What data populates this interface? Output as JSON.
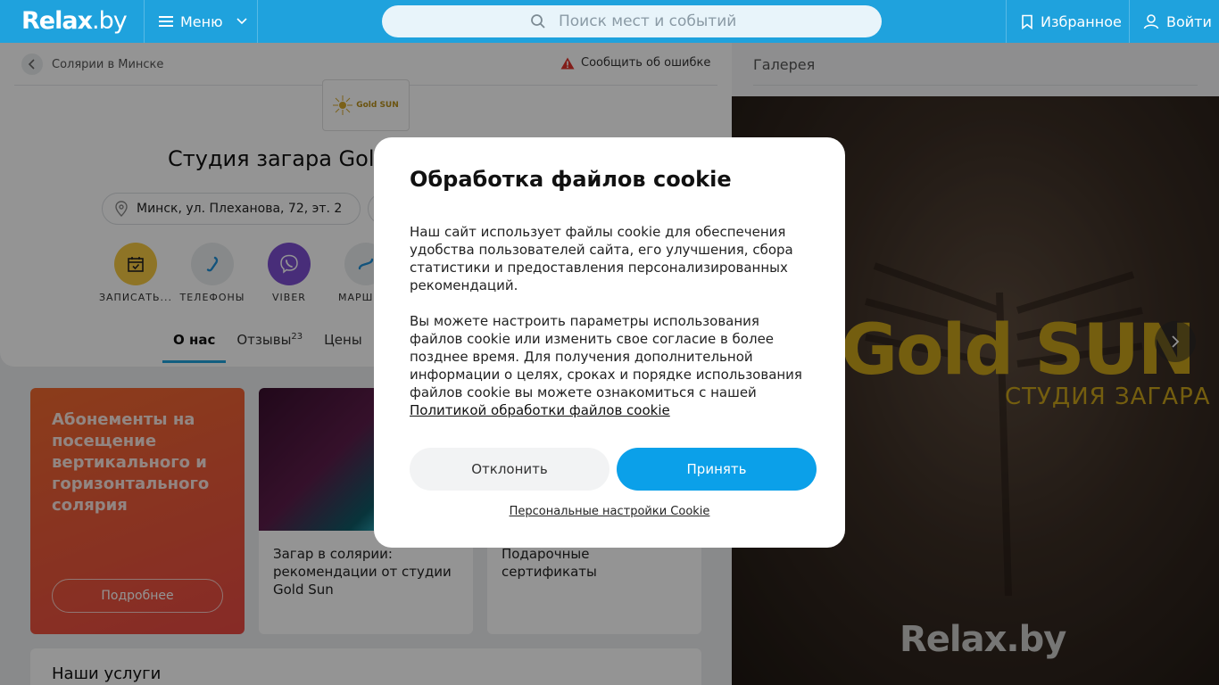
{
  "header": {
    "logo_main": "Relax",
    "logo_suffix": ".by",
    "menu_label": "Меню",
    "search_placeholder": "Поиск мест и событий",
    "favorites_label": "Избранное",
    "login_label": "Войти",
    "bg_color": "#1fa2dd"
  },
  "page": {
    "breadcrumb": "Солярии в Минске",
    "report_error": "Сообщить об ошибке",
    "brand_logo_text": "Gold SUN",
    "title": "Студия загара Gol",
    "address": "Минск, ул. Плеханова, 72, эт. 2",
    "actions": [
      {
        "label": "ЗАПИСАТЬ...",
        "icon": "calendar-check-icon",
        "color": "#f5c842"
      },
      {
        "label": "ТЕЛЕФОНЫ",
        "icon": "phone-icon",
        "color": "#e9ecee"
      },
      {
        "label": "VIBER",
        "icon": "viber-icon",
        "color": "#7c4fd1"
      },
      {
        "label": "МАРШ",
        "icon": "route-icon",
        "color": "#e9ecee"
      }
    ],
    "tabs": [
      {
        "label": "О нас",
        "active": true
      },
      {
        "label": "Отзывы",
        "count": "23"
      },
      {
        "label": "Цены"
      }
    ]
  },
  "promos": {
    "main_title": "Абонементы на посещение вертикального и горизонтального солярия",
    "main_button": "Подробнее",
    "card1_text": "Загар в солярии: рекомендации от студии Gold Sun",
    "card2_text": "Подарочные сертификаты"
  },
  "services_title": "Наши услуги",
  "gallery": {
    "title": "Галерея",
    "image_brand": "Gold SUN",
    "image_subtitle": "СТУДИЯ ЗАГАРА",
    "image_watermark": "Relax.by"
  },
  "cookie_modal": {
    "title": "Обработка файлов cookie",
    "para1": "Наш сайт использует файлы cookie для обеспечения удобства пользователей сайта, его улучшения, сбора статистики и предоставления персонализированных рекомендаций.",
    "para2": "Вы можете настроить параметры использования файлов cookie или изменить свое согласие в более позднее время. Для получения дополнительной информации о целях, сроках и порядке использования файлов cookie вы можете ознакомиться с нашей",
    "policy_link": "Политикой обработки файлов cookie",
    "decline_label": "Отклонить",
    "accept_label": "Принять",
    "personal_settings": "Персональные настройки Cookie",
    "accept_color": "#0ba0e9"
  }
}
